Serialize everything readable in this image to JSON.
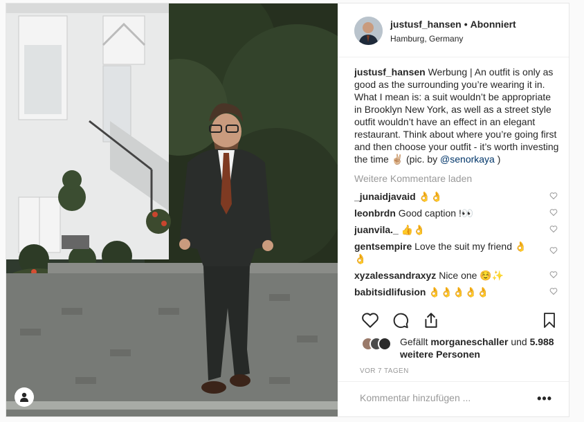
{
  "post": {
    "username": "justusf_hansen",
    "follow_status": "Abonniert",
    "separator": "•",
    "location": "Hamburg, Germany",
    "caption": {
      "username": "justusf_hansen",
      "text_before": "Werbung | An outfit is only as good as the surrounding you’re wearing it in. What I mean is: a suit wouldn’t be appropriate in Brooklyn New York, as well as a street style outfit wouldn’t have an effect in an elegant restaurant. Think about where you’re going first and then choose your outfit - it’s worth investing the time ✌🏼 (pic. by ",
      "mention": "@senorkaya",
      "text_after": " )"
    },
    "load_more_label": "Weitere Kommentare laden",
    "comments": [
      {
        "user": "_junaidjavaid",
        "text": "👌👌"
      },
      {
        "user": "leonbrdn",
        "text": "Good caption !👀"
      },
      {
        "user": "juanvila._",
        "text": "👍👌"
      },
      {
        "user": "gentsempire",
        "text": "Love the suit my friend 👌👌"
      },
      {
        "user": "xyzalessandraxyz",
        "text": "Nice one ☺️✨"
      },
      {
        "user": "babitsidlifusion",
        "text": "👌👌👌👌👌"
      }
    ],
    "likes": {
      "prefix": "Gefällt",
      "user": "morganeschaller",
      "connector": "und",
      "count_text": "5.988 weitere Personen"
    },
    "timestamp": "VOR 7 TAGEN",
    "comment_placeholder": "Kommentar hinzufügen ...",
    "more_options": "•••",
    "icons": {
      "like": "heart-icon",
      "comment": "comment-icon",
      "share": "share-icon",
      "save": "bookmark-icon",
      "tag": "user-tag-icon"
    },
    "colors": {
      "text": "#262626",
      "muted": "#999999",
      "mention": "#003569",
      "border": "#efefef"
    }
  }
}
